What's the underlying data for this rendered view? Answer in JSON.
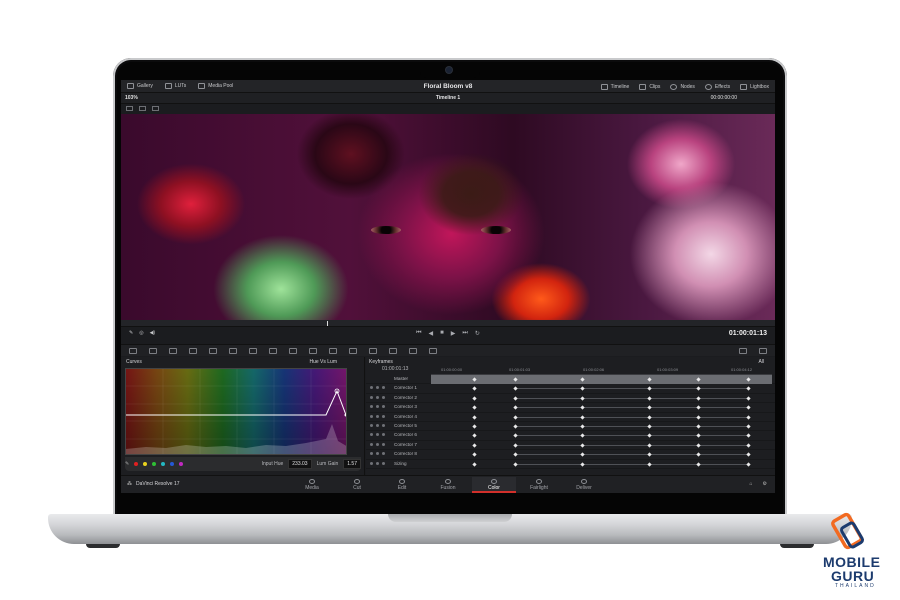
{
  "app": {
    "project_title": "Floral Bloom v8",
    "timeline_name": "Timeline 1",
    "zoom": "103%",
    "header_timecode": "00:00:00:00"
  },
  "topbar": {
    "left": [
      {
        "label": "Gallery",
        "icon": "gallery-icon"
      },
      {
        "label": "LUTs",
        "icon": "lut-icon"
      },
      {
        "label": "Media Pool",
        "icon": "media-pool-icon"
      }
    ],
    "right": [
      {
        "label": "Timeline",
        "icon": "timeline-icon"
      },
      {
        "label": "Clips",
        "icon": "clips-icon"
      },
      {
        "label": "Nodes",
        "icon": "nodes-icon"
      },
      {
        "label": "Effects",
        "icon": "effects-icon"
      },
      {
        "label": "Lightbox",
        "icon": "lightbox-icon"
      }
    ]
  },
  "viewer": {
    "timecode": "01:00:01:13"
  },
  "curves": {
    "panel_title": "Curves",
    "mode": "Hue Vs Lum",
    "input_hue_label": "Input Hue",
    "input_hue_value": "233.03",
    "lum_gain_label": "Lum Gain",
    "lum_gain_value": "1.57",
    "swatches": [
      "#e02020",
      "#e8d21e",
      "#2fbf35",
      "#24b8c2",
      "#2459d6",
      "#c129c1"
    ]
  },
  "keyframes": {
    "panel_title": "Keyframes",
    "filter": "All",
    "current_tc": "01:00:01:13",
    "ruler": [
      "01:00:00:00",
      "01:00:01:03",
      "01:00:02:06",
      "01:00:03:09",
      "01:00:04:12"
    ],
    "rows": [
      "Master",
      "Corrector 1",
      "Corrector 2",
      "Corrector 3",
      "Corrector 4",
      "Corrector 5",
      "Corrector 6",
      "Corrector 7",
      "Corrector 8",
      "Sizing"
    ]
  },
  "pages": {
    "brand": "DaVinci Resolve 17",
    "tabs": [
      "Media",
      "Cut",
      "Edit",
      "Fusion",
      "Color",
      "Fairlight",
      "Deliver"
    ],
    "active": "Color"
  },
  "watermark": {
    "line1": "MOBILE",
    "line2": "GURU",
    "line3": "THAILAND"
  }
}
